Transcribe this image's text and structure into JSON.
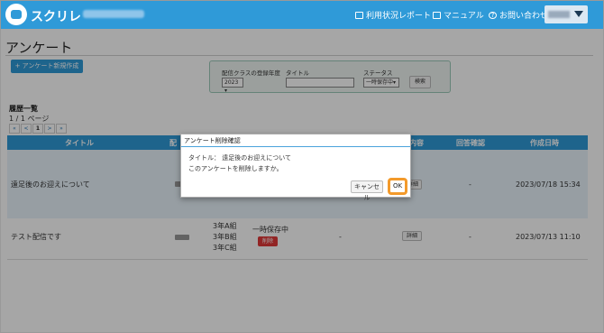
{
  "header": {
    "brand": "スクリレ",
    "nav": [
      {
        "label": "利用状況レポート",
        "icon": "report-icon"
      },
      {
        "label": "マニュアル",
        "icon": "book-icon"
      },
      {
        "label": "お問い合わせ",
        "icon": "question-icon"
      }
    ]
  },
  "page": {
    "title": "アンケート",
    "new_button": "+ アンケート新規作成"
  },
  "filter": {
    "year_label": "配信クラスの登録年度",
    "year_value": "2023",
    "title_label": "タイトル",
    "status_label": "ステータス",
    "status_value": "一時保存中",
    "search_button": "検索"
  },
  "history": {
    "section_title": "履歴一覧",
    "page_count": "1 / 1 ページ",
    "pager": [
      "«",
      "<",
      "1",
      ">",
      "»"
    ]
  },
  "table": {
    "headers": [
      "タイトル",
      "配",
      "内容",
      "回答確認",
      "作成日時"
    ],
    "rows": [
      {
        "title": "遠足後のお迎えについて",
        "detail": "詳細",
        "answer": "-",
        "created": "2023/07/18 15:34"
      },
      {
        "title": "テスト配信です",
        "classes": [
          "3年A組",
          "3年B組",
          "3年C組"
        ],
        "status": "一時保存中",
        "delete": "削除",
        "dash": "-",
        "detail": "詳細",
        "answer": "-",
        "created": "2023/07/13 11:10"
      }
    ]
  },
  "dialog": {
    "title": "アンケート削除確認",
    "line1": "タイトル： 遠足後のお迎えについて",
    "line2": "このアンケートを削除しますか。",
    "cancel": "キャンセル",
    "ok": "OK"
  },
  "colors": {
    "accent": "#2f9ad8",
    "highlight": "#f39a2b",
    "danger": "#e03a3a"
  }
}
